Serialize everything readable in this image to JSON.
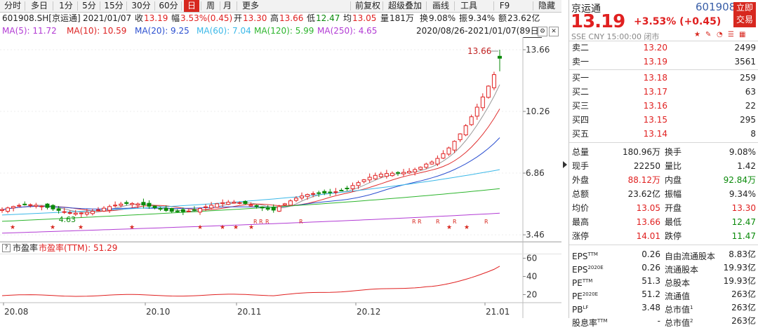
{
  "toolbar": {
    "periods": [
      "分时",
      "多日",
      "1分",
      "5分",
      "15分",
      "30分",
      "60分",
      "日",
      "周",
      "月",
      "更多"
    ],
    "active": "日",
    "tools": [
      "前复权",
      "超级叠加",
      "画线",
      "工具",
      "F9",
      "隐藏"
    ]
  },
  "info": {
    "code": "601908.SH[京运通]",
    "date": "2021/01/07",
    "close_label": "收",
    "close": "13.19",
    "amp_label": "幅",
    "amp": "3.53%(0.45)",
    "open_label": "开",
    "open": "13.30",
    "high_label": "高",
    "high": "13.66",
    "low_label": "低",
    "low": "12.47",
    "avg_label": "均",
    "avg": "13.05",
    "vol_label": "量",
    "vol": "181万",
    "turn_label": "换",
    "turn": "9.08%",
    "swing_label": "振",
    "swing": "9.34%",
    "amount_label": "额",
    "amount": "23.62亿"
  },
  "ma": {
    "ma5": "MA(5): 11.72",
    "ma10": "MA(10): 10.59",
    "ma20": "MA(20): 9.25",
    "ma60": "MA(60): 7.04",
    "ma120": "MA(120): 5.99",
    "ma250": "MA(250): 4.65",
    "range": "2020/08/26-2021/01/07(89日)"
  },
  "colors": {
    "up": "#e02020",
    "down": "#0a8a0a",
    "ma5": "#999999",
    "ma10": "#e03030",
    "ma20": "#2b4fd0",
    "ma60": "#3bb8e8",
    "ma120": "#2db52d",
    "ma250": "#b23bd4"
  },
  "chart": {
    "y_ticks": [
      "13.66",
      "10.26",
      "6.86",
      "3.46"
    ],
    "high_label": "13.66",
    "low_label": "4.63",
    "marker_star": "★",
    "marker_r": "R",
    "x_ticks": [
      "20.08",
      "20.10",
      "20.11",
      "20.12",
      "21.01"
    ],
    "ind_ticks": [
      "60",
      "40",
      "20"
    ]
  },
  "chart_data": {
    "type": "candlestick",
    "x_range": [
      "2020/08/26",
      "2021/01/07"
    ],
    "ylim": [
      3.0,
      14.2
    ],
    "last": {
      "open": 13.3,
      "high": 13.66,
      "low": 12.47,
      "close": 13.19
    },
    "ma_last": {
      "MA5": 11.72,
      "MA10": 10.59,
      "MA20": 9.25,
      "MA60": 7.04,
      "MA120": 5.99,
      "MA250": 4.65
    },
    "pe_ttm_last": 51.29
  },
  "indicator": {
    "q": "?",
    "name": "市盈率",
    "line_label": "市盈率(TTM): 51.29"
  },
  "panel": {
    "name": "京运通",
    "code": "601908",
    "price": "13.19",
    "change": "+3.53% (+0.45)",
    "exchange": "SSE  CNY  15:00:00  闭市",
    "trade_btn": [
      "立即",
      "交易"
    ],
    "sell": [
      {
        "label": "卖二",
        "price": "13.20",
        "vol": "2499"
      },
      {
        "label": "卖一",
        "price": "13.19",
        "vol": "3561"
      }
    ],
    "buy": [
      {
        "label": "买一",
        "price": "13.18",
        "vol": "259"
      },
      {
        "label": "买二",
        "price": "13.17",
        "vol": "63"
      },
      {
        "label": "买三",
        "price": "13.16",
        "vol": "22"
      },
      {
        "label": "买四",
        "price": "13.15",
        "vol": "295"
      },
      {
        "label": "买五",
        "price": "13.14",
        "vol": "8"
      }
    ],
    "stats": [
      {
        "k1": "总量",
        "v1": "180.96万",
        "k2": "换手",
        "v2": "9.08%",
        "c1": "blk",
        "c2": "blk"
      },
      {
        "k1": "现手",
        "v1": "22250",
        "k2": "量比",
        "v2": "1.42",
        "c1": "blk",
        "c2": "blk"
      },
      {
        "k1": "外盘",
        "v1": "88.12万",
        "k2": "内盘",
        "v2": "92.84万",
        "c1": "red",
        "c2": "grn"
      },
      {
        "k1": "总额",
        "v1": "23.62亿",
        "k2": "振幅",
        "v2": "9.34%",
        "c1": "blk",
        "c2": "blk"
      },
      {
        "k1": "均价",
        "v1": "13.05",
        "k2": "开盘",
        "v2": "13.30",
        "c1": "red",
        "c2": "red"
      },
      {
        "k1": "最高",
        "v1": "13.66",
        "k2": "最低",
        "v2": "12.47",
        "c1": "red",
        "c2": "grn"
      },
      {
        "k1": "涨停",
        "v1": "14.01",
        "k2": "跌停",
        "v2": "11.47",
        "c1": "red",
        "c2": "grn"
      }
    ],
    "fund": [
      {
        "k1": "EPS",
        "s1": "TTM",
        "v1": "0.26",
        "k2": "自由流通股本",
        "s2": "",
        "v2": "8.83亿"
      },
      {
        "k1": "EPS",
        "s1": "2020E",
        "v1": "0.26",
        "k2": "流通股本",
        "s2": "",
        "v2": "19.93亿"
      },
      {
        "k1": "PE",
        "s1": "TTM",
        "v1": "51.3",
        "k2": "总股本",
        "s2": "",
        "v2": "19.93亿"
      },
      {
        "k1": "PE",
        "s1": "2020E",
        "v1": "51.2",
        "k2": "流通值",
        "s2": "",
        "v2": "263亿"
      },
      {
        "k1": "PB",
        "s1": "LF",
        "v1": "3.48",
        "k2": "总市值",
        "s2": "1",
        "v2": "263亿"
      },
      {
        "k1": "股息率",
        "s1": "TTM",
        "v1": "-",
        "k2": "总市值",
        "s2": "2",
        "v2": "263亿"
      }
    ]
  }
}
